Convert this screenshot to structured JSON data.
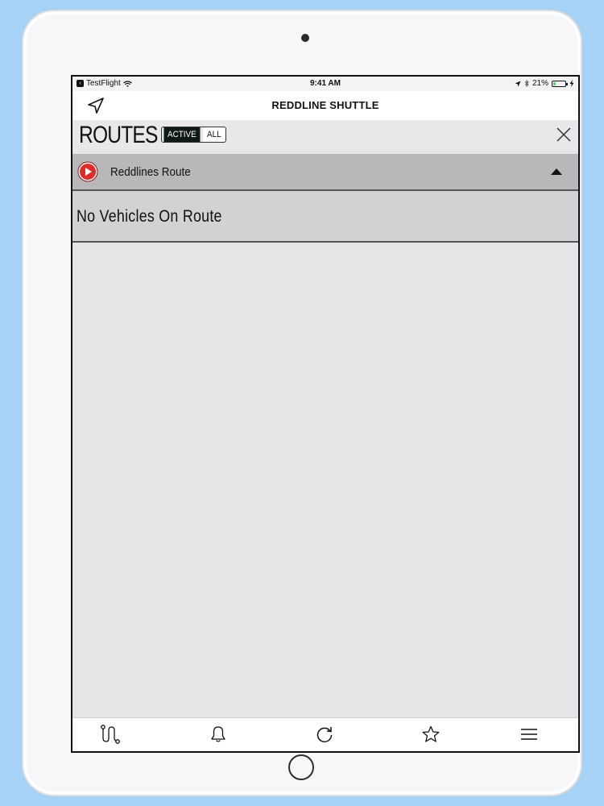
{
  "status_bar": {
    "back_app": "TestFlight",
    "time": "9:41 AM",
    "battery_percent": "21%",
    "battery_level": 0.21
  },
  "nav": {
    "title": "REDDLINE SHUTTLE",
    "left_icon": "location-arrow-icon"
  },
  "routes": {
    "heading": "ROUTES",
    "filter": {
      "options": [
        "ACTIVE",
        "ALL"
      ],
      "selected": "ACTIVE"
    },
    "close_icon": "close-icon"
  },
  "route_list": [
    {
      "name": "Reddlines Route",
      "icon": "play-circle-icon",
      "icon_color": "#e02b2b",
      "expanded": true,
      "message": "No Vehicles On Route"
    }
  ],
  "tab_bar": {
    "tabs": [
      {
        "icon": "route-icon"
      },
      {
        "icon": "bell-icon"
      },
      {
        "icon": "refresh-icon"
      },
      {
        "icon": "star-icon"
      },
      {
        "icon": "menu-icon"
      }
    ]
  },
  "colors": {
    "background": "#a6d3f5",
    "accent_red": "#e02b2b",
    "active_segment": "#0f1a14"
  }
}
